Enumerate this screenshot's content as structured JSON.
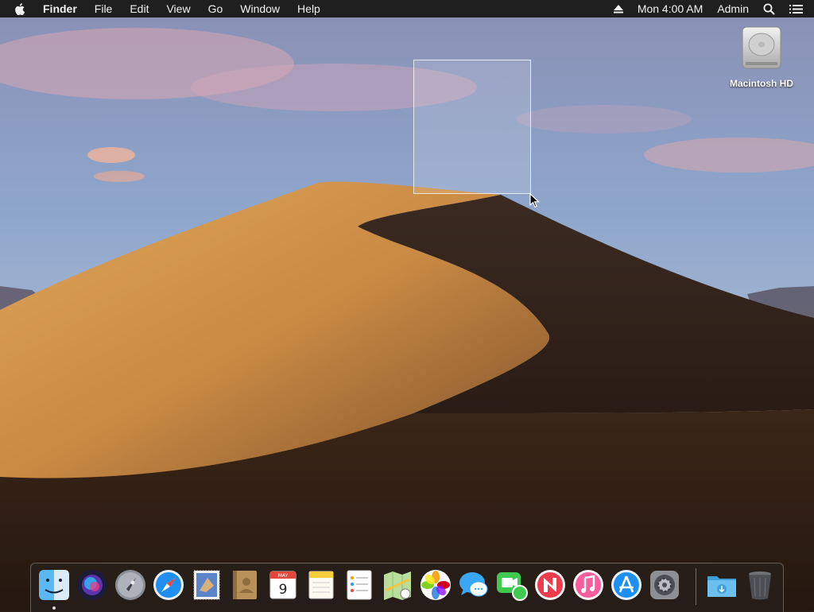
{
  "menubar": {
    "apple_icon": "apple-icon",
    "items": [
      "Finder",
      "File",
      "Edit",
      "View",
      "Go",
      "Window",
      "Help"
    ],
    "status": {
      "eject_icon": "eject-icon",
      "clock": "Mon 4:00 AM",
      "user": "Admin",
      "spotlight_icon": "search-icon",
      "notification_icon": "list-icon"
    }
  },
  "desktop": {
    "icons": [
      {
        "label": "Macintosh HD",
        "icon": "hard-drive-icon"
      }
    ]
  },
  "dock": {
    "apps": [
      "Finder",
      "Siri",
      "Launchpad",
      "Safari",
      "Mail",
      "Contacts",
      "Calendar",
      "Notes",
      "Reminders",
      "Maps",
      "Photos",
      "Messages",
      "FaceTime",
      "News",
      "iTunes",
      "App Store",
      "System Preferences",
      "Downloads",
      "Trash"
    ],
    "calendar_month": "MAY",
    "calendar_day": "9"
  },
  "colors": {
    "menubar_bg": "#1f1f1f",
    "sky_top": "#8fa0c4",
    "dune_light": "#d79a4e",
    "dune_dark": "#2f2119"
  }
}
